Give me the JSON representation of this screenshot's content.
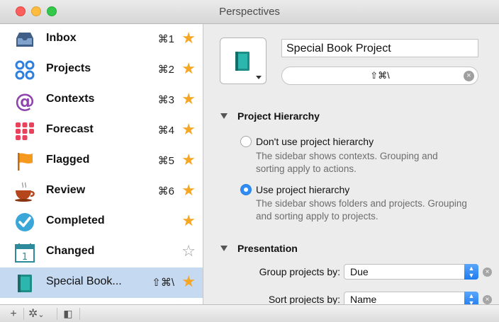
{
  "window": {
    "title": "Perspectives"
  },
  "sidebar": {
    "items": [
      {
        "label": "Inbox",
        "shortcut": "⌘1",
        "star": "★",
        "icon": "inbox-icon"
      },
      {
        "label": "Projects",
        "shortcut": "⌘2",
        "star": "★",
        "icon": "projects-icon"
      },
      {
        "label": "Contexts",
        "shortcut": "⌘3",
        "star": "★",
        "icon": "contexts-icon"
      },
      {
        "label": "Forecast",
        "shortcut": "⌘4",
        "star": "★",
        "icon": "forecast-icon"
      },
      {
        "label": "Flagged",
        "shortcut": "⌘5",
        "star": "★",
        "icon": "flag-icon"
      },
      {
        "label": "Review",
        "shortcut": "⌘6",
        "star": "★",
        "icon": "review-icon"
      },
      {
        "label": "Completed",
        "shortcut": "",
        "star": "★",
        "icon": "completed-icon"
      },
      {
        "label": "Changed",
        "shortcut": "",
        "star": "☆",
        "icon": "calendar-icon",
        "calendar_day": "1"
      },
      {
        "label": "Special Book...",
        "shortcut": "⇧⌘\\",
        "star": "★",
        "icon": "book-icon",
        "selected": true
      }
    ]
  },
  "toolbar": {
    "add": "+",
    "gear": "✲",
    "gear_chevron": "⌄",
    "sidebar_toggle": "◧"
  },
  "detail": {
    "name": "Special Book Project",
    "shortcut": "⇧⌘\\",
    "shortcut_clear": "×",
    "hierarchy": {
      "header": "Project Hierarchy",
      "option1_label": "Don't use project hierarchy",
      "option1_desc": "The sidebar shows contexts. Grouping and sorting apply to actions.",
      "option2_label": "Use project hierarchy",
      "option2_desc": "The sidebar shows folders and projects. Grouping and sorting apply to projects.",
      "selected": 2
    },
    "presentation": {
      "header": "Presentation",
      "group_label": "Group projects by:",
      "group_value": "Due",
      "sort_label": "Sort projects by:",
      "sort_value": "Name",
      "clear": "×"
    }
  },
  "colors": {
    "accent": "#2f8cf5",
    "star": "#f5a623",
    "selection": "#c5d9f1"
  }
}
